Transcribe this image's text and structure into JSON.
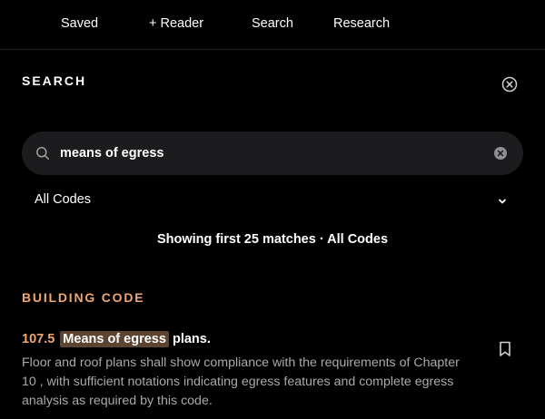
{
  "nav": {
    "items": [
      {
        "label": "Saved"
      },
      {
        "label": "+ Reader"
      },
      {
        "label": "Search"
      },
      {
        "label": "Research"
      }
    ]
  },
  "search_panel": {
    "title": "SEARCH",
    "close_icon": "close-circle-icon",
    "query": "means of egress",
    "search_icon": "search-icon",
    "clear_icon": "clear-circle-icon",
    "code_filter": {
      "selected": "All Codes",
      "icon": "chevron-down-icon"
    },
    "summary": "Showing first 25 matches · All Codes"
  },
  "results": {
    "category": "BUILDING CODE",
    "items": [
      {
        "section": "107.5",
        "match": "Means of egress",
        "title_rest": "plans.",
        "body": "Floor and roof plans shall show compliance with the requirements of Chapter 10 , with sufficient notations indicating egress features and complete egress analysis as required by this code.",
        "bookmark_icon": "bookmark-icon"
      }
    ]
  },
  "colors": {
    "background": "#000000",
    "accent": "#f0a66e",
    "highlight": "#5c4430",
    "input_bg": "#1c1c1e",
    "muted_text": "#a9a9a9"
  }
}
